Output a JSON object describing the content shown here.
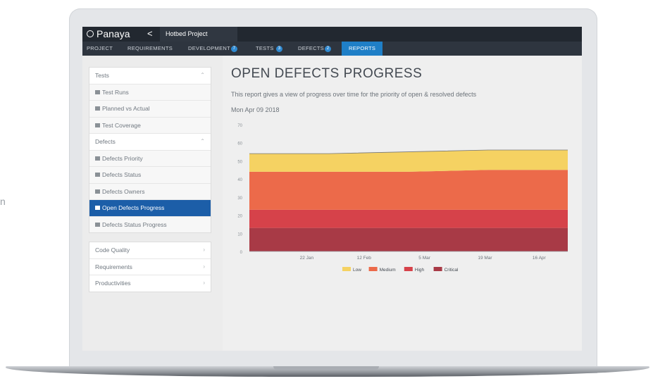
{
  "side_text": "n",
  "app": {
    "logo": "Panaya",
    "back_glyph": "<",
    "project_tab": "Hotbed Project"
  },
  "nav": {
    "project": "PROJECT",
    "requirements": "REQUIREMENTS",
    "development": "DEVELOPMENT",
    "development_badge": "7",
    "tests": "TESTS",
    "tests_badge": "3",
    "defects": "DEFECTS",
    "defects_badge": "2",
    "reports": "REPORTS"
  },
  "sidebar": {
    "tests_header": "Tests",
    "tests_items": [
      "Test Runs",
      "Planned vs Actual",
      "Test Coverage"
    ],
    "defects_header": "Defects",
    "defects_items": [
      "Defects Priority",
      "Defects Status",
      "Defects Owners",
      "Open Defects Progress",
      "Defects Status Progress"
    ],
    "other_items": [
      "Code Quality",
      "Requirements",
      "Productivities"
    ]
  },
  "page": {
    "title": "OPEN DEFECTS PROGRESS",
    "description": "This report gives a view of progress over time for the priority of open & resolved defects",
    "date": "Mon Apr 09 2018"
  },
  "chart_data": {
    "type": "area",
    "stacked": true,
    "x": [
      "22 Jan",
      "12 Feb",
      "5 Mar",
      "19 Mar",
      "16 Apr"
    ],
    "y_ticks": [
      0,
      10,
      20,
      30,
      40,
      50,
      60,
      70
    ],
    "ylim": [
      0,
      70
    ],
    "series": [
      {
        "name": "Critical",
        "color": "#a83a46",
        "values": [
          13,
          13,
          13,
          13,
          13
        ]
      },
      {
        "name": "High",
        "color": "#d6424a",
        "values": [
          10,
          10,
          10,
          10,
          10
        ]
      },
      {
        "name": "Medium",
        "color": "#ec6a4a",
        "values": [
          21,
          21,
          21,
          22,
          22
        ]
      },
      {
        "name": "Low",
        "color": "#f5d262",
        "values": [
          10,
          10,
          11,
          11,
          11
        ]
      }
    ],
    "legend": [
      "Low",
      "Medium",
      "High",
      "Critical"
    ],
    "legend_position": "bottom"
  }
}
